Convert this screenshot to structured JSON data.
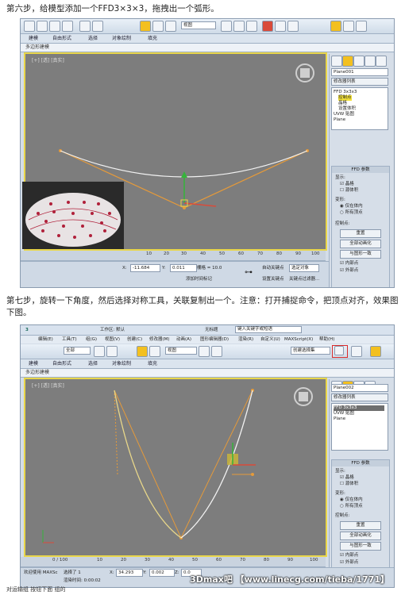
{
  "step6": {
    "text": "第六步，给模型添加一个FFD3×3×3，拖拽出一个弧形。"
  },
  "step7": {
    "text": "第七步，旋转一下角度，然后选择对称工具，关联复制出一个。注意：打开捕捉命令，把顶点对齐，效果图下图。"
  },
  "shot1": {
    "tabs": [
      "建模",
      "自由形式",
      "选择",
      "对象绘制",
      "填充"
    ],
    "ribbon": "多边形建模",
    "viewport_label": "[+] [透] [真实]",
    "toolbar_dropdown": "视图",
    "object_name": "Plane001",
    "modifier_list": "修改器列表",
    "stack_items": [
      "FFD 3x3x3",
      "控制点",
      "晶格",
      "设置体积",
      "UVW 贴图",
      "Plane"
    ],
    "rollout_title": "FFD 参数",
    "display_label": "显示:",
    "display_opts": [
      "晶格",
      "源体积"
    ],
    "deform_label": "变形:",
    "deform_opts": [
      "仅在体内",
      "所有顶点"
    ],
    "control_label": "控制点:",
    "buttons": [
      "重置",
      "全部动画化",
      "与图形一致"
    ],
    "checks": [
      "内部点",
      "外部点"
    ],
    "ruler": [
      "10",
      "20",
      "30",
      "40",
      "50",
      "60",
      "70",
      "80",
      "90",
      "100"
    ],
    "coord_x": "-11.684",
    "coord_y": "0.011",
    "grid": "栅格 = 10.0",
    "add_time_tag": "添加时间标记",
    "auto_key": "自动关键点",
    "set_key": "设置关键点",
    "selected": "选定对象",
    "key_filter": "关键点过滤器...",
    "frame": "0"
  },
  "shot2": {
    "app_title": "无标题",
    "search": "键入关键字或短语",
    "menus": [
      "编辑(E)",
      "工具(T)",
      "组(G)",
      "视图(V)",
      "创建(C)",
      "修改器(M)",
      "动画(A)",
      "图形编辑器(D)",
      "渲染(R)",
      "自定义(U)",
      "MAXScript(X)",
      "帮助(H)"
    ],
    "workspace": "工作区: 默认",
    "select_all": "全部",
    "toolbar_dropdown": "视图",
    "selection_set": "创建选择集",
    "tabs": [
      "建模",
      "自由形式",
      "选择",
      "对象绘制",
      "填充"
    ],
    "ribbon": "多边形建模",
    "viewport_label": "[+] [透] [真实]",
    "object_name": "Plane002",
    "modifier_list": "修改器列表",
    "stack_items": [
      "FFD 3x3x3",
      "UVW 贴图",
      "Plane"
    ],
    "rollout_title": "FFD 参数",
    "display_label": "显示:",
    "display_opts": [
      "晶格",
      "源体积"
    ],
    "deform_label": "变形:",
    "deform_opts": [
      "仅在体内",
      "所有顶点"
    ],
    "control_label": "控制点:",
    "buttons": [
      "重置",
      "全部动画化",
      "与图形一致"
    ],
    "checks": [
      "内部点",
      "外部点"
    ],
    "frame_counter": "0 / 100",
    "ruler": [
      "0",
      "10",
      "20",
      "30",
      "40",
      "50",
      "60",
      "70",
      "80",
      "90",
      "100"
    ],
    "status": "选择了 1",
    "coord_x": "34.293",
    "coord_y": "0.002",
    "coord_z": "0.0",
    "welcome": "欢迎使用 MAXSc",
    "render_time": "渲染时间: 0:00:02"
  },
  "bottom_text": "对运输组 按钮下面 组的",
  "watermark": "3Dmax吧 【www.linecg.com/tieba/1771】",
  "colors": {
    "viewport": "#7d7d7d",
    "lattice": "#e59a3a",
    "curve": "#f2f2f2",
    "active": "#e9d64a",
    "accent": "#d94b3a"
  }
}
